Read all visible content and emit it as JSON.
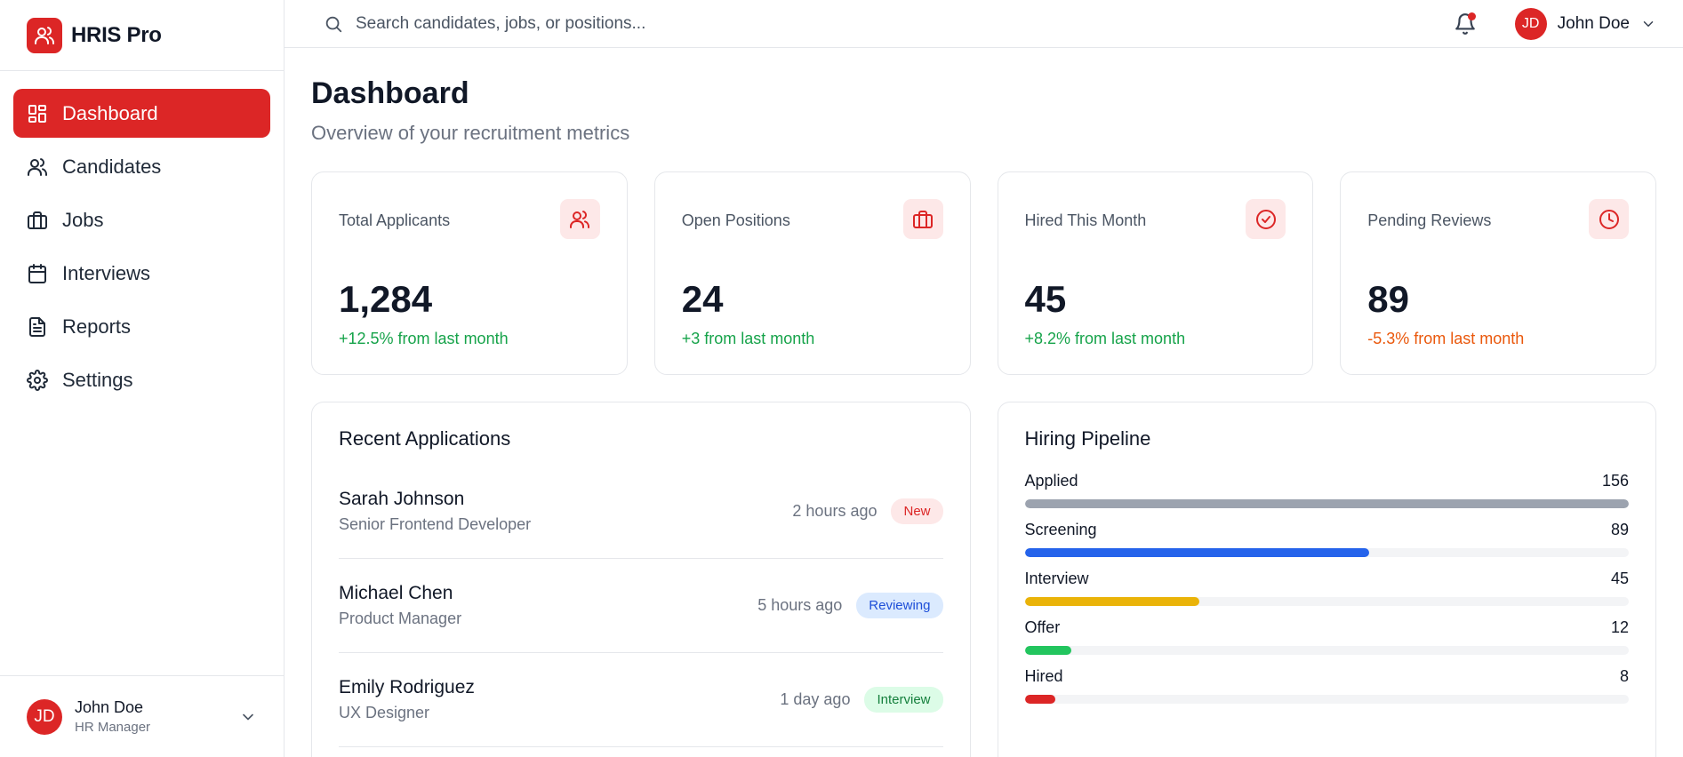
{
  "brand": {
    "name": "HRIS Pro"
  },
  "colors": {
    "accent": "#dc2626",
    "positive": "#16a34a",
    "negative": "#ea580c",
    "pipeline_applied": "#9ca3af",
    "pipeline_screening": "#2563eb",
    "pipeline_interview": "#eab308",
    "pipeline_offer": "#22c55e",
    "pipeline_hired": "#dc2626"
  },
  "sidebar": {
    "items": [
      {
        "label": "Dashboard",
        "icon": "dashboard-icon",
        "active": true
      },
      {
        "label": "Candidates",
        "icon": "users-icon"
      },
      {
        "label": "Jobs",
        "icon": "briefcase-icon"
      },
      {
        "label": "Interviews",
        "icon": "calendar-icon"
      },
      {
        "label": "Reports",
        "icon": "document-icon"
      },
      {
        "label": "Settings",
        "icon": "gear-icon"
      }
    ],
    "user": {
      "initials": "JD",
      "name": "John Doe",
      "role": "HR Manager"
    }
  },
  "header": {
    "search_placeholder": "Search candidates, jobs, or positions...",
    "notifications_icon": "bell-icon",
    "user": {
      "initials": "JD",
      "name": "John Doe"
    }
  },
  "page": {
    "title": "Dashboard",
    "subtitle": "Overview of your recruitment metrics"
  },
  "stats": [
    {
      "label": "Total Applicants",
      "value": "1,284",
      "change": "+12.5% from last month",
      "trend": "positive",
      "icon": "users-icon"
    },
    {
      "label": "Open Positions",
      "value": "24",
      "change": "+3 from last month",
      "trend": "positive",
      "icon": "briefcase-icon"
    },
    {
      "label": "Hired This Month",
      "value": "45",
      "change": "+8.2% from last month",
      "trend": "positive",
      "icon": "check-circle-icon"
    },
    {
      "label": "Pending Reviews",
      "value": "89",
      "change": "-5.3% from last month",
      "trend": "negative",
      "icon": "clock-icon"
    }
  ],
  "recent_applications": {
    "title": "Recent Applications",
    "items": [
      {
        "name": "Sarah Johnson",
        "role": "Senior Frontend Developer",
        "time": "2 hours ago",
        "status": "New"
      },
      {
        "name": "Michael Chen",
        "role": "Product Manager",
        "time": "5 hours ago",
        "status": "Reviewing"
      },
      {
        "name": "Emily Rodriguez",
        "role": "UX Designer",
        "time": "1 day ago",
        "status": "Interview"
      }
    ]
  },
  "pipeline": {
    "title": "Hiring Pipeline",
    "max": 156,
    "stages": [
      {
        "label": "Applied",
        "count": "156",
        "value": 156
      },
      {
        "label": "Screening",
        "count": "89",
        "value": 89
      },
      {
        "label": "Interview",
        "count": "45",
        "value": 45
      },
      {
        "label": "Offer",
        "count": "12",
        "value": 12
      },
      {
        "label": "Hired",
        "count": "8",
        "value": 8
      }
    ]
  }
}
